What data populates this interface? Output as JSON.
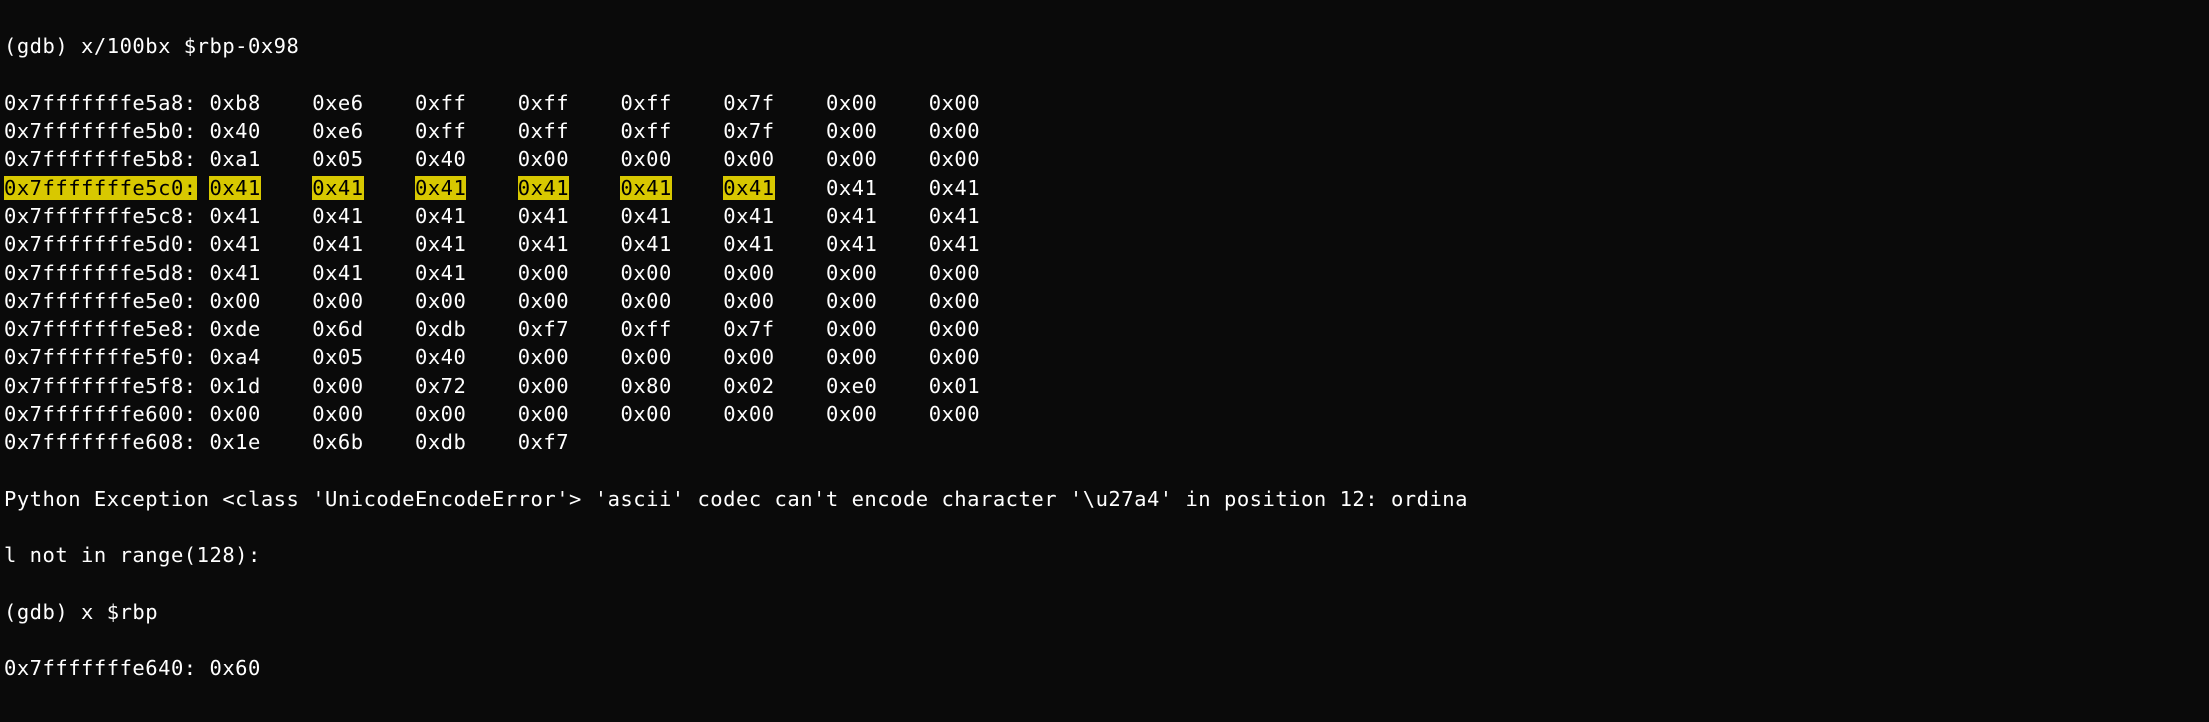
{
  "truncated_top": "l not in range(128):",
  "gdb_command_1": "(gdb) x/100bx $rbp-0x98",
  "mem_rows": [
    {
      "addr": "0x7fffffffe5a8:",
      "bytes": [
        "0xb8",
        "0xe6",
        "0xff",
        "0xff",
        "0xff",
        "0x7f",
        "0x00",
        "0x00"
      ],
      "hl_addr": false,
      "hl_bytes": []
    },
    {
      "addr": "0x7fffffffe5b0:",
      "bytes": [
        "0x40",
        "0xe6",
        "0xff",
        "0xff",
        "0xff",
        "0x7f",
        "0x00",
        "0x00"
      ],
      "hl_addr": false,
      "hl_bytes": []
    },
    {
      "addr": "0x7fffffffe5b8:",
      "bytes": [
        "0xa1",
        "0x05",
        "0x40",
        "0x00",
        "0x00",
        "0x00",
        "0x00",
        "0x00"
      ],
      "hl_addr": false,
      "hl_bytes": []
    },
    {
      "addr": "0x7fffffffe5c0:",
      "bytes": [
        "0x41",
        "0x41",
        "0x41",
        "0x41",
        "0x41",
        "0x41",
        "0x41",
        "0x41"
      ],
      "hl_addr": true,
      "hl_bytes": [
        0,
        1,
        2,
        3,
        4,
        5
      ]
    },
    {
      "addr": "0x7fffffffe5c8:",
      "bytes": [
        "0x41",
        "0x41",
        "0x41",
        "0x41",
        "0x41",
        "0x41",
        "0x41",
        "0x41"
      ],
      "hl_addr": false,
      "hl_bytes": []
    },
    {
      "addr": "0x7fffffffe5d0:",
      "bytes": [
        "0x41",
        "0x41",
        "0x41",
        "0x41",
        "0x41",
        "0x41",
        "0x41",
        "0x41"
      ],
      "hl_addr": false,
      "hl_bytes": []
    },
    {
      "addr": "0x7fffffffe5d8:",
      "bytes": [
        "0x41",
        "0x41",
        "0x41",
        "0x00",
        "0x00",
        "0x00",
        "0x00",
        "0x00"
      ],
      "hl_addr": false,
      "hl_bytes": []
    },
    {
      "addr": "0x7fffffffe5e0:",
      "bytes": [
        "0x00",
        "0x00",
        "0x00",
        "0x00",
        "0x00",
        "0x00",
        "0x00",
        "0x00"
      ],
      "hl_addr": false,
      "hl_bytes": []
    },
    {
      "addr": "0x7fffffffe5e8:",
      "bytes": [
        "0xde",
        "0x6d",
        "0xdb",
        "0xf7",
        "0xff",
        "0x7f",
        "0x00",
        "0x00"
      ],
      "hl_addr": false,
      "hl_bytes": []
    },
    {
      "addr": "0x7fffffffe5f0:",
      "bytes": [
        "0xa4",
        "0x05",
        "0x40",
        "0x00",
        "0x00",
        "0x00",
        "0x00",
        "0x00"
      ],
      "hl_addr": false,
      "hl_bytes": []
    },
    {
      "addr": "0x7fffffffe5f8:",
      "bytes": [
        "0x1d",
        "0x00",
        "0x72",
        "0x00",
        "0x80",
        "0x02",
        "0xe0",
        "0x01"
      ],
      "hl_addr": false,
      "hl_bytes": []
    },
    {
      "addr": "0x7fffffffe600:",
      "bytes": [
        "0x00",
        "0x00",
        "0x00",
        "0x00",
        "0x00",
        "0x00",
        "0x00",
        "0x00"
      ],
      "hl_addr": false,
      "hl_bytes": []
    },
    {
      "addr": "0x7fffffffe608:",
      "bytes": [
        "0x1e",
        "0x6b",
        "0xdb",
        "0xf7"
      ],
      "hl_addr": false,
      "hl_bytes": []
    }
  ],
  "exception_line1": "Python Exception <class 'UnicodeEncodeError'> 'ascii' codec can't encode character '\\u27a4' in position 12: ordina",
  "exception_line2": "l not in range(128):",
  "gdb_command_2": "(gdb) x $rbp",
  "result_line": "0x7fffffffe640: 0x60"
}
